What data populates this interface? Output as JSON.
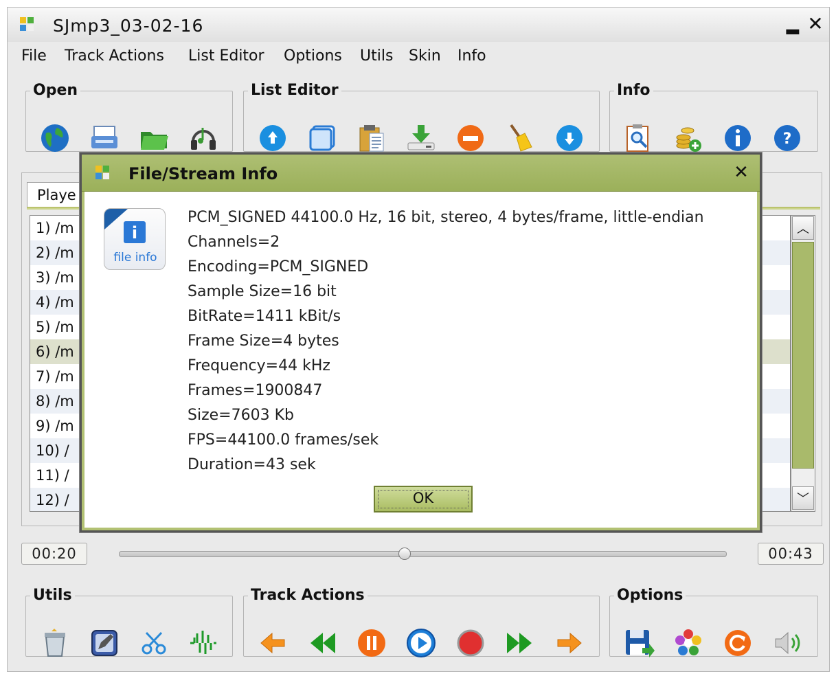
{
  "window": {
    "title": "SJmp3_03-02-16",
    "minimize_icon": "minimize-icon",
    "close_icon": "close-icon"
  },
  "menubar": {
    "items": [
      "File",
      "Track Actions",
      "List Editor",
      "Options",
      "Utils",
      "Skin",
      "Info"
    ]
  },
  "toolbars": {
    "open": {
      "label": "Open",
      "icons": [
        "globe-icon",
        "scanner-icon",
        "folder-icon",
        "music-headphones-icon"
      ]
    },
    "list_editor": {
      "label": "List Editor",
      "icons": [
        "move-up-icon",
        "select-all-icon",
        "clipboard-icon",
        "download-icon",
        "remove-icon",
        "broom-icon",
        "move-down-icon"
      ]
    },
    "info": {
      "label": "Info",
      "icons": [
        "file-search-icon",
        "coins-add-icon",
        "info-icon",
        "help-icon"
      ]
    },
    "utils": {
      "label": "Utils",
      "icons": [
        "recycle-bin-icon",
        "edit-icon",
        "scissors-icon",
        "waveform-icon"
      ]
    },
    "track_actions": {
      "label": "Track Actions",
      "icons": [
        "back-arrow-icon",
        "rewind-icon",
        "pause-icon",
        "play-icon",
        "record-icon",
        "fast-forward-icon",
        "forward-arrow-icon"
      ]
    },
    "options": {
      "label": "Options",
      "icons": [
        "save-icon",
        "skin-flower-icon",
        "refresh-icon",
        "volume-icon"
      ]
    }
  },
  "playlist": {
    "tab_label": "Playe",
    "rows": [
      "1) /m",
      "2) /m",
      "3) /m",
      "4) /m",
      "5) /m",
      "6) /m",
      "7) /m",
      "8) /m",
      "9) /m",
      "10) /",
      "11) /",
      "12) /"
    ],
    "selected_row": 6
  },
  "player": {
    "elapsed": "00:20",
    "total": "00:43",
    "progress": 0.47
  },
  "dialog": {
    "title": "File/Stream Info",
    "icon_label": "file info",
    "icon_letter": "i",
    "lines": [
      "PCM_SIGNED 44100.0 Hz, 16 bit, stereo, 4 bytes/frame, little-endian",
      "Channels=2",
      "Encoding=PCM_SIGNED",
      "Sample Size=16 bit",
      "BitRate=1411 kBit/s",
      "Frame Size=4 bytes",
      "Frequency=44 kHz",
      "Frames=1900847",
      "Size=7603 Kb",
      "FPS=44100.0 frames/sek",
      "Duration=43 sek"
    ],
    "ok_label": "OK"
  },
  "colors": {
    "accent_green": "#a9ba6b",
    "dialog_title_bg": "#9bb05a",
    "row_alt": "#ecf0f6",
    "row_selected": "#dde0cc"
  }
}
